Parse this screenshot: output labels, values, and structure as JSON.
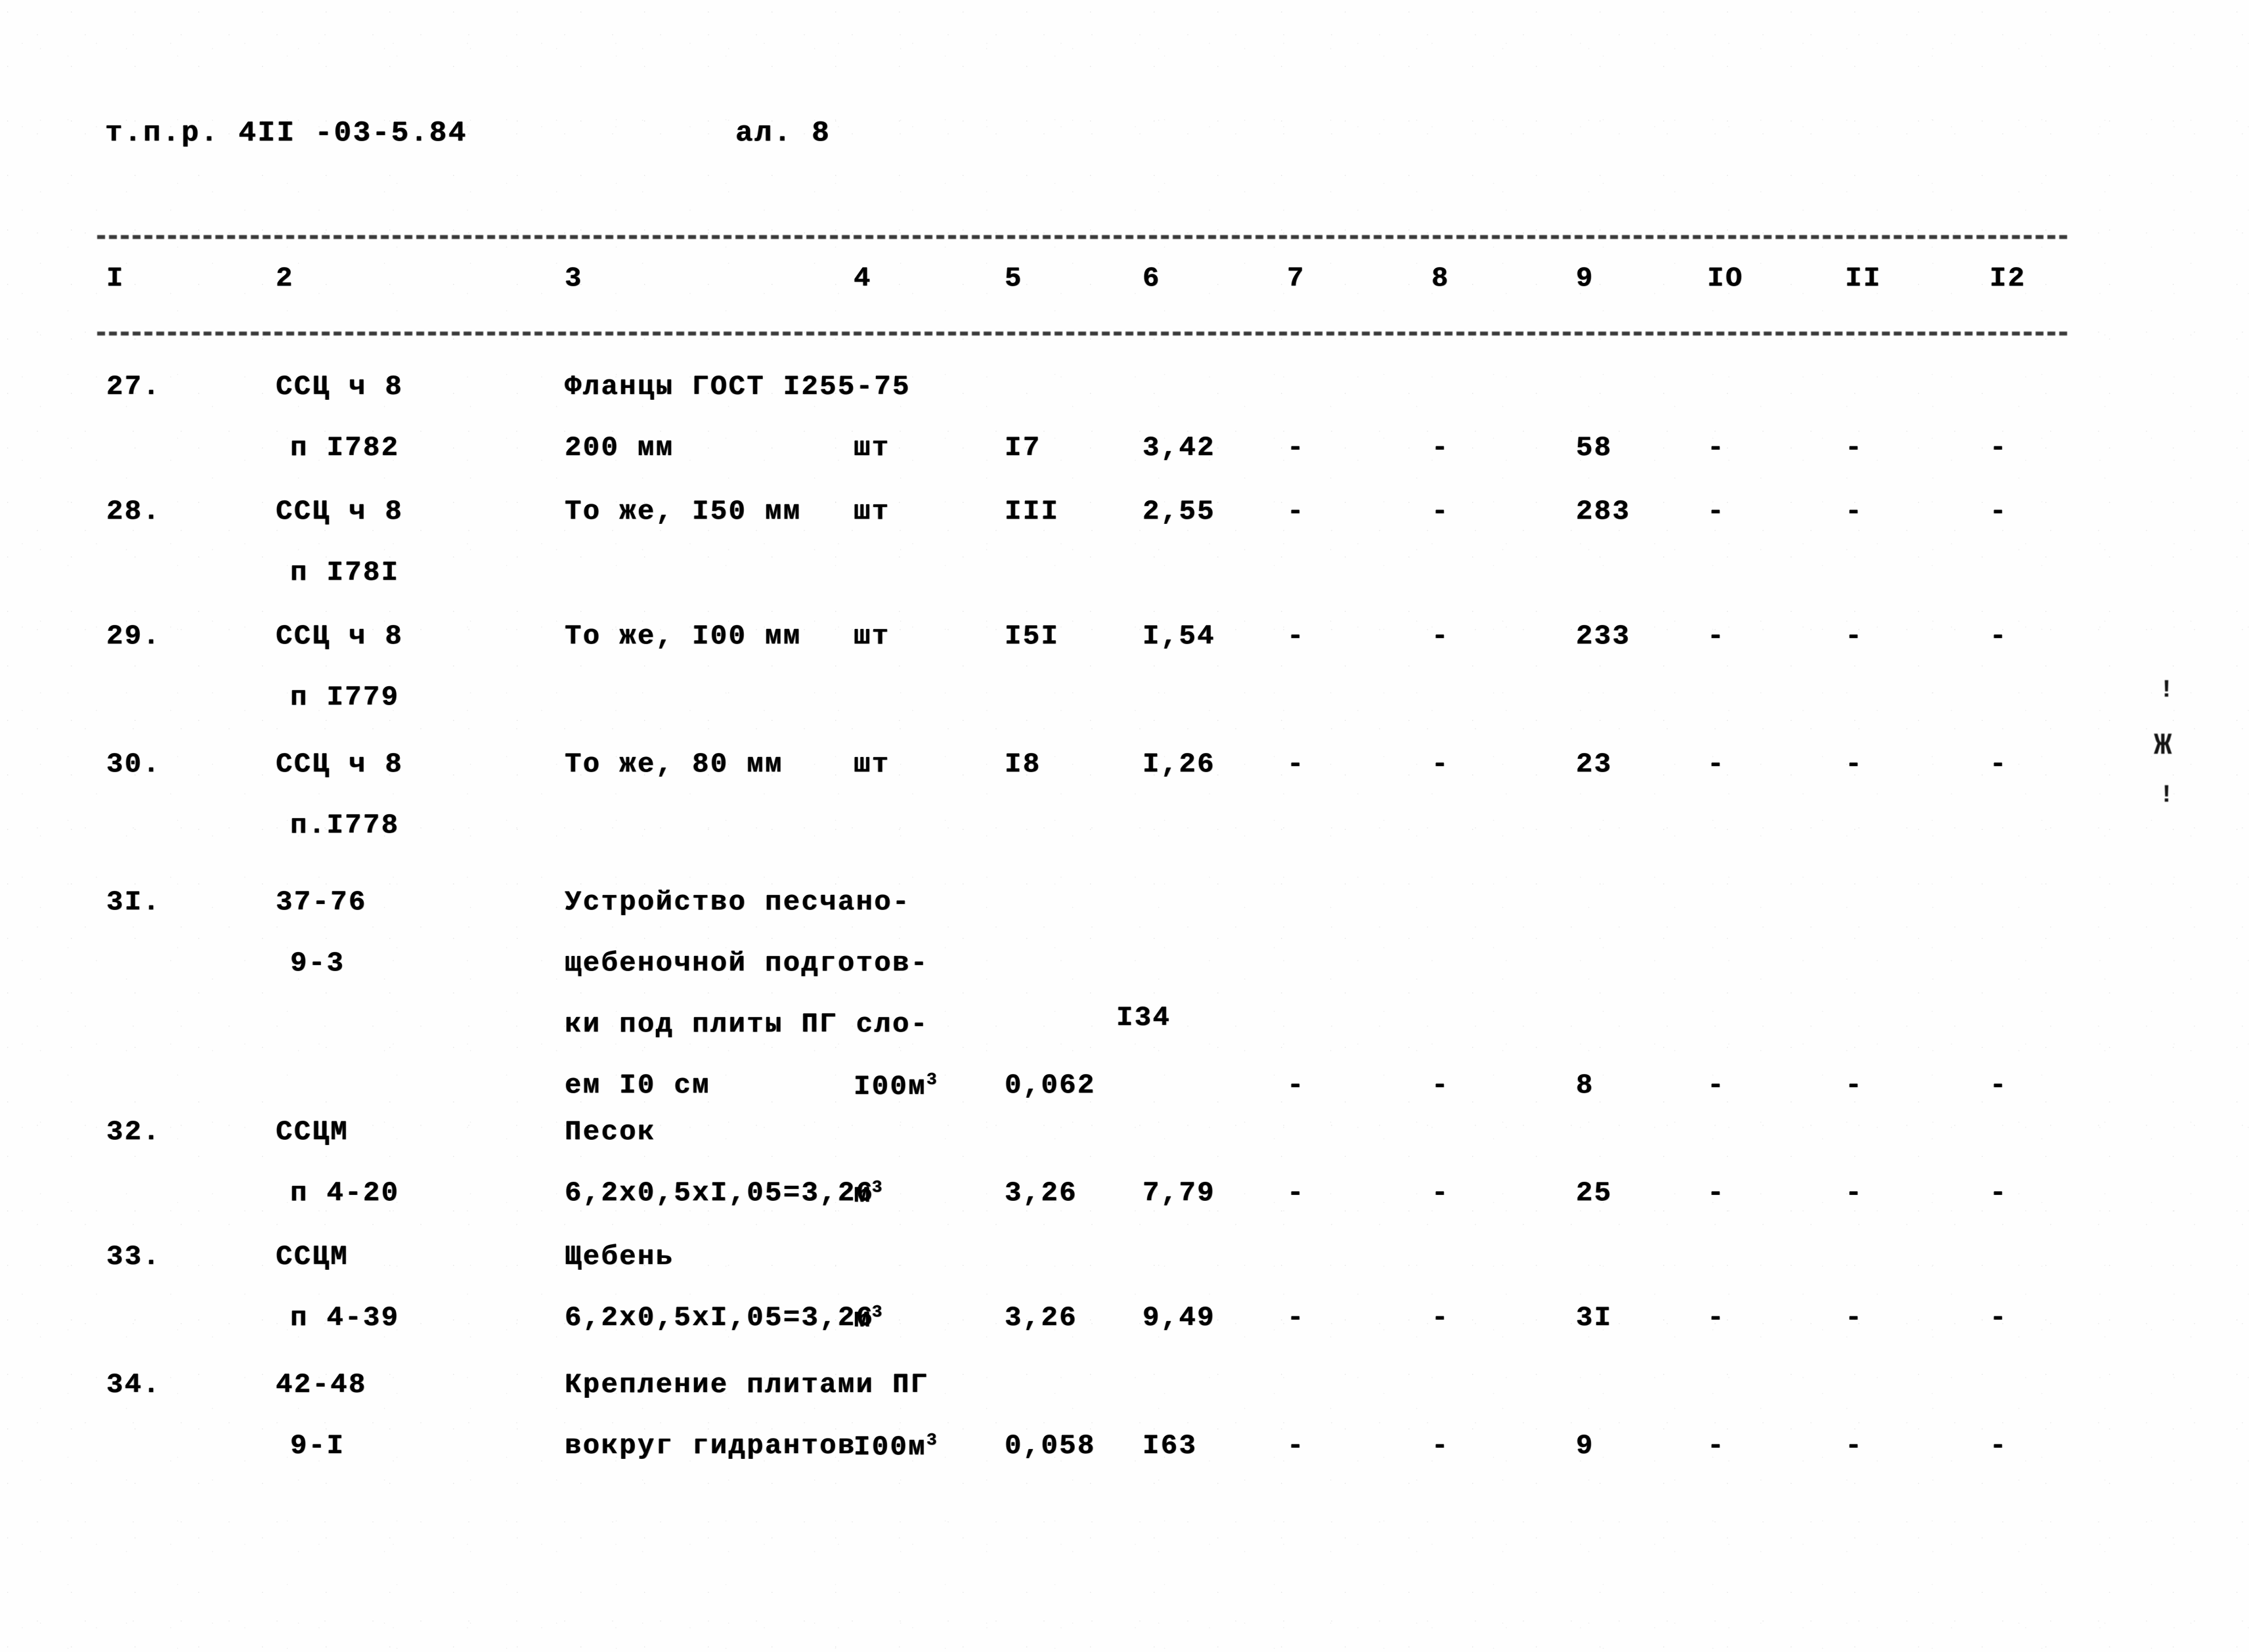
{
  "document": {
    "header_left": "т.п.р. 4II -03-5.84",
    "header_right": "ал. 8"
  },
  "table": {
    "column_headers": [
      "I",
      "2",
      "3",
      "4",
      "5",
      "6",
      "7",
      "8",
      "9",
      "IO",
      "II",
      "I2"
    ],
    "rows": [
      {
        "num": "27.",
        "code_lines": [
          "ССЦ ч 8",
          "п I782"
        ],
        "desc_lines": [
          "Фланцы ГОСТ I255-75",
          "200 мм"
        ],
        "unit": "шт",
        "col5": "I7",
        "col6": "3,42",
        "col7": "-",
        "col8": "-",
        "col9": "58",
        "col10": "-",
        "col11": "-",
        "col12": "-",
        "note": ""
      },
      {
        "num": "28.",
        "code_lines": [
          "ССЦ ч 8",
          "п I78I"
        ],
        "desc_lines": [
          "То же, I50 мм"
        ],
        "unit": "шт",
        "col5": "III",
        "col6": "2,55",
        "col7": "-",
        "col8": "-",
        "col9": "283",
        "col10": "-",
        "col11": "-",
        "col12": "-",
        "note": ""
      },
      {
        "num": "29.",
        "code_lines": [
          "ССЦ ч 8",
          "п I779"
        ],
        "desc_lines": [
          "То же, I00 мм"
        ],
        "unit": "шт",
        "col5": "I5I",
        "col6": "I,54",
        "col7": "-",
        "col8": "-",
        "col9": "233",
        "col10": "-",
        "col11": "-",
        "col12": "-",
        "note": ""
      },
      {
        "num": "30.",
        "code_lines": [
          "ССЦ ч 8",
          "п.I778"
        ],
        "desc_lines": [
          "То же, 80 мм"
        ],
        "unit": "шт",
        "col5": "I8",
        "col6": "I,26",
        "col7": "-",
        "col8": "-",
        "col9": "23",
        "col10": "-",
        "col11": "-",
        "col12": "-",
        "note": ""
      },
      {
        "num": "3I.",
        "code_lines": [
          "37-76",
          "9-3"
        ],
        "desc_lines": [
          "Устройство песчано-",
          "щебеночной подготов-",
          "ки под плиты ПГ сло-",
          "ем I0 см"
        ],
        "unit": "I00м",
        "unit_sup": "3",
        "col5": "0,062",
        "col6": "",
        "col6_above": "I34",
        "col7": "-",
        "col8": "-",
        "col9": "8",
        "col10": "-",
        "col11": "-",
        "col12": "-",
        "note": ""
      },
      {
        "num": "32.",
        "code_lines": [
          "ССЦМ",
          "п 4-20"
        ],
        "desc_lines": [
          "Песок",
          "6,2х0,5хI,05=3,26"
        ],
        "unit": "м",
        "unit_sup": "3",
        "col5": "3,26",
        "col6": "7,79",
        "col7": "-",
        "col8": "-",
        "col9": "25",
        "col10": "-",
        "col11": "-",
        "col12": "-",
        "note": ""
      },
      {
        "num": "33.",
        "code_lines": [
          "ССЦМ",
          "п 4-39"
        ],
        "desc_lines": [
          "Щебень",
          "6,2х0,5хI,05=3,26"
        ],
        "unit": "м",
        "unit_sup": "3",
        "col5": "3,26",
        "col6": "9,49",
        "col7": "-",
        "col8": "-",
        "col9": "3I",
        "col10": "-",
        "col11": "-",
        "col12": "-",
        "note": ""
      },
      {
        "num": "34.",
        "code_lines": [
          "42-48",
          "9-I"
        ],
        "desc_lines": [
          "Крепление плитами ПГ",
          "вокруг гидрантов"
        ],
        "unit": "I00м",
        "unit_sup": "3",
        "col5": "0,058",
        "col6": "I63",
        "col7": "-",
        "col8": "-",
        "col9": "9",
        "col10": "-",
        "col11": "-",
        "col12": "-",
        "note": ""
      }
    ]
  },
  "margin_marks": {
    "top_tick": "!",
    "middle_mark": "Ж",
    "bottom_tick": "!"
  }
}
